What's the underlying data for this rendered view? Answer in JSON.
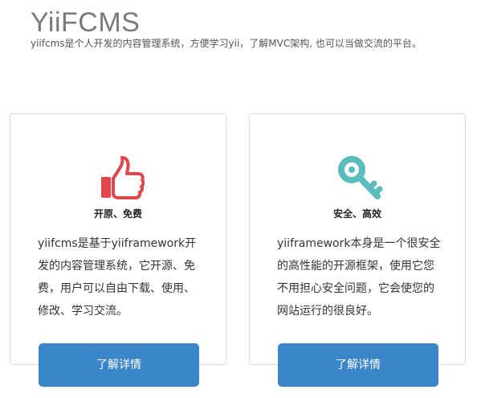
{
  "header": {
    "title": "YiiFCMS",
    "description": "yiifcms是个人开发的内容管理系统，方便学习yii，了解MVC架构, 也可以当做交流的平台。"
  },
  "colors": {
    "thumb": "#e0474c",
    "key": "#5bbcbc",
    "button": "#3b86c9"
  },
  "cards": [
    {
      "icon": "thumbs-up-icon",
      "feature": "开原、免费",
      "lines": [
        "yiifcms是基于yiiframework开",
        "发的内容管理系统，它开源、免",
        "费，用户可以自由下载、使用、",
        "修改、学习交流。"
      ],
      "button": "了解详情"
    },
    {
      "icon": "key-icon",
      "feature": "安全、高效",
      "lines": [
        "yiiframework本身是一个很安全",
        "的高性能的开源框架，使用它您",
        "不用担心安全问题，它会使您的",
        "网站运行的很良好。"
      ],
      "button": "了解详情"
    }
  ]
}
